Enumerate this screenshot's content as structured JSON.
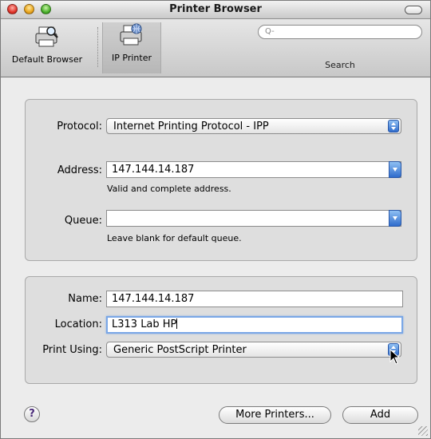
{
  "window": {
    "title": "Printer Browser"
  },
  "toolbar": {
    "default_browser_label": "Default Browser",
    "ip_printer_label": "IP Printer",
    "search_placeholder": "Q-",
    "search_label": "Search"
  },
  "connection": {
    "protocol_label": "Protocol:",
    "protocol_value": "Internet Printing Protocol - IPP",
    "address_label": "Address:",
    "address_value": "147.144.14.187",
    "address_hint": "Valid and complete address.",
    "queue_label": "Queue:",
    "queue_value": "",
    "queue_hint": "Leave blank for default queue."
  },
  "printer": {
    "name_label": "Name:",
    "name_value": "147.144.14.187",
    "location_label": "Location:",
    "location_value": "L313 Lab HP",
    "print_using_label": "Print Using:",
    "print_using_value": "Generic PostScript Printer"
  },
  "footer": {
    "help_label": "?",
    "more_printers_label": "More Printers...",
    "add_label": "Add"
  }
}
